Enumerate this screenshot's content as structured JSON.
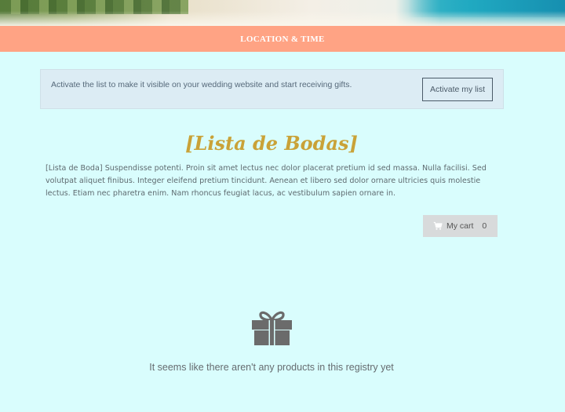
{
  "nav": {
    "items": [
      "LOCATION & TIME"
    ]
  },
  "activate_notice": {
    "text": "Activate the list to make it visible on your wedding website and start receiving gifts.",
    "button_label": "Activate my list"
  },
  "registry": {
    "title": "[Lista de Bodas]",
    "description": "[Lista de Boda] Suspendisse potenti. Proin sit amet lectus nec dolor placerat pretium id sed massa. Nulla facilisi. Sed volutpat aliquet finibus. Integer eleifend pretium tincidunt. Aenean et libero sed dolor ornare ultricies quis molestie lectus. Etiam nec pharetra enim. Nam rhoncus feugiat lacus, ac vestibulum sapien ornare in."
  },
  "cart": {
    "label": "My cart",
    "count": "0",
    "icon": "cart-icon"
  },
  "empty_state": {
    "icon": "gift-icon",
    "message": "It seems like there aren't any products in this registry yet"
  },
  "colors": {
    "background": "#d9fdfd",
    "nav_bar": "#ffa384",
    "title_gold": "#c9a238",
    "notice_bg": "#dcecf4",
    "cart_bg": "#d8dadb"
  }
}
